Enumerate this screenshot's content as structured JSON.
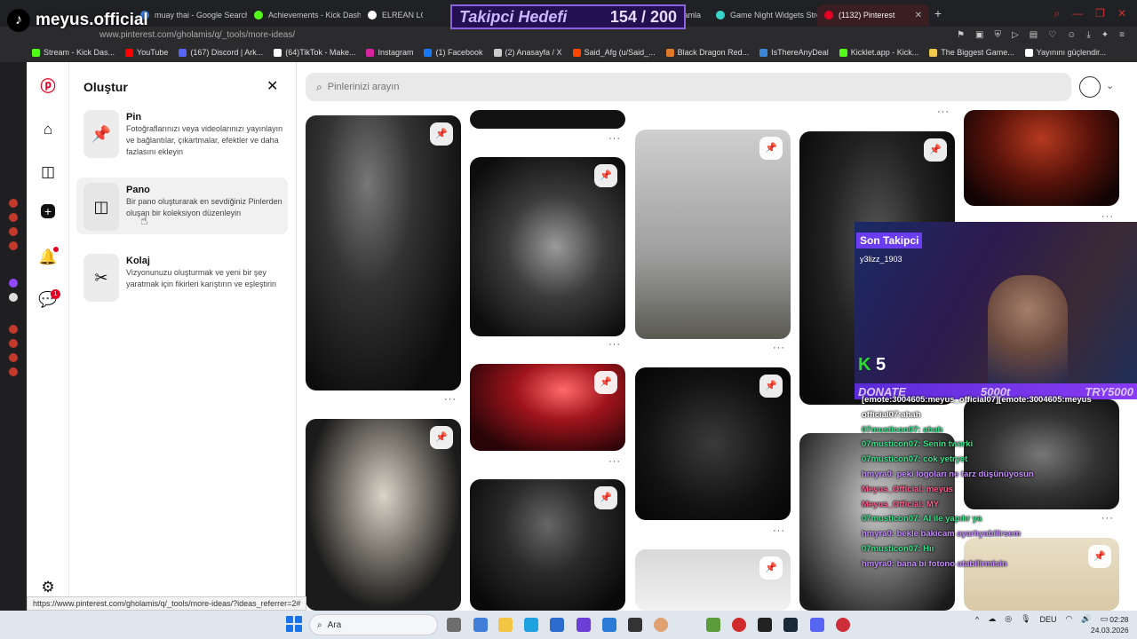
{
  "browser": {
    "tabs": [
      {
        "label": "muay thai - Google Search",
        "color": "#4285f4",
        "active": false
      },
      {
        "label": "Achievements - Kick Dash",
        "color": "#53fc18",
        "active": false
      },
      {
        "label": "ELREAN LO",
        "color": "#ffffff",
        "active": false
      },
      {
        "label": "/ Streamla",
        "color": "#888888",
        "active": false
      },
      {
        "label": "Game Night Widgets Stre",
        "color": "#38d6c8",
        "active": false
      },
      {
        "label": "(1132) Pinterest",
        "color": "#e60023",
        "active": true
      }
    ],
    "url": "www.pinterest.com/gholamis/q/_tools/more-ideas/",
    "bookmarks": [
      {
        "label": "Stream - Kick Das...",
        "color": "#53fc18"
      },
      {
        "label": "YouTube",
        "color": "#ff0000"
      },
      {
        "label": "(167) Discord | Ark...",
        "color": "#5865f2"
      },
      {
        "label": "(64)TikTok - Make...",
        "color": "#ffffff"
      },
      {
        "label": "Instagram",
        "color": "#d6249f"
      },
      {
        "label": "(1) Facebook",
        "color": "#1877f2"
      },
      {
        "label": "(2) Anasayfa / X",
        "color": "#cccccc"
      },
      {
        "label": "Said_Afg (u/Said_...",
        "color": "#ff4500"
      },
      {
        "label": "Black Dragon Red...",
        "color": "#e07b2a"
      },
      {
        "label": "IsThereAnyDeal",
        "color": "#3a87d9"
      },
      {
        "label": "Kicklet.app - Kick...",
        "color": "#53fc18"
      },
      {
        "label": "The Biggest Game...",
        "color": "#f2c94c"
      },
      {
        "label": "Yayınını güçlendir...",
        "color": "#ffffff"
      }
    ]
  },
  "brand": {
    "name": "meyus.official"
  },
  "goal_widget": {
    "label": "Takipci Hedefi",
    "value": "154 / 200"
  },
  "create_panel": {
    "title": "Oluştur",
    "items": [
      {
        "name": "Pin",
        "desc": "Fotoğraflarınızı veya videolarınızı yayınlayın ve bağlantılar, çıkartmalar, efektler ve daha fazlasını ekleyin"
      },
      {
        "name": "Pano",
        "desc": "Bir pano oluşturarak en sevdiğiniz Pinlerden oluşan bir koleksiyon düzenleyin"
      },
      {
        "name": "Kolaj",
        "desc": "Vizyonunuzu oluşturmak ve yeni bir şey yaratmak için fikirleri karıştırın ve eşleştirin"
      }
    ]
  },
  "search": {
    "placeholder": "Pinlerinizi arayın"
  },
  "nav": {
    "notification_dot": true,
    "messages_badge": "1"
  },
  "status_url": "https://www.pinterest.com/gholamis/q/_tools/more-ideas/?ideas_referrer=2#",
  "overlay": {
    "last_follower_label": "Son Takipci",
    "last_follower": "y3lizz_1903",
    "count": "5",
    "donate_label": "DONATE",
    "donate_value": "5000t",
    "donate_currency": "TRY5000"
  },
  "chat": [
    "[emote:3004605:meyus_official07][emote:3004605:meyus",
    "official07:ahah",
    "07musticon07: ahah",
    "07musticon07: Senin twerki",
    "07musticon07: cok yetryet",
    "hmyra0: peki logoları ne tarz düşünüyosun",
    "Meyus_Official: meyus",
    "Meyus_Official: MY",
    "07musticon07: AI ile yapılır ya",
    "hmyra0: bekle bakicam ayarlıyabilirsem",
    "07musticon07: Hıı",
    "hmyra0: bana bi fotono atabilirmisin"
  ],
  "taskbar": {
    "search_label": "Ara",
    "lang": "DEU",
    "time": "02:28",
    "date": "24.03.2026"
  }
}
